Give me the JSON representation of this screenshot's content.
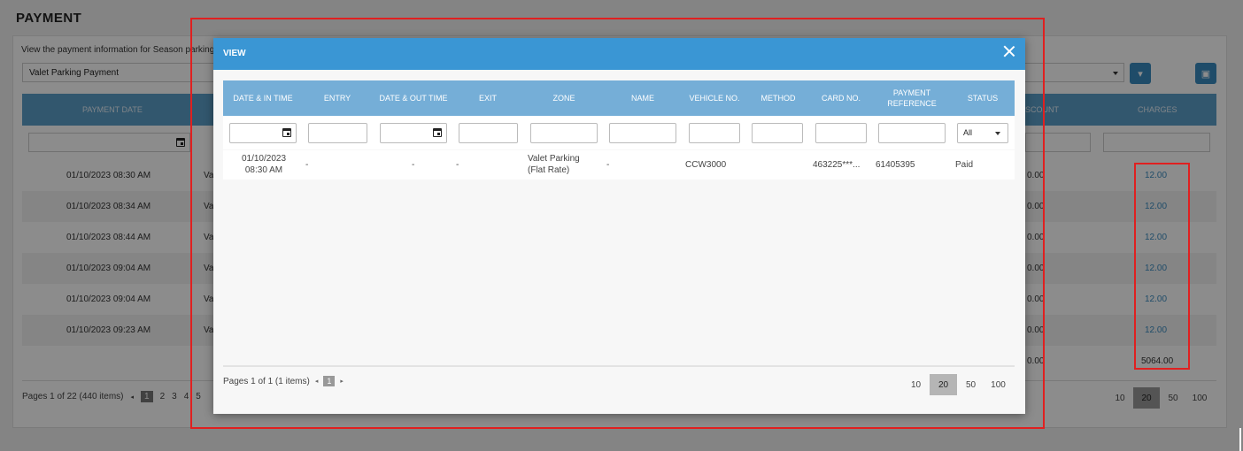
{
  "page": {
    "title": "PAYMENT",
    "description": "View the payment information for Season parking a",
    "payment_type": "Valet Parking Payment",
    "columns": {
      "payment_date": "PAYMENT DATE",
      "discount": "SCOUNT",
      "charges": "CHARGES"
    },
    "rows": [
      {
        "date": "01/10/2023 08:30 AM",
        "type": "Va",
        "discount": "0.00",
        "charges": "12.00"
      },
      {
        "date": "01/10/2023 08:34 AM",
        "type": "Va",
        "discount": "0.00",
        "charges": "12.00"
      },
      {
        "date": "01/10/2023 08:44 AM",
        "type": "Va",
        "discount": "0.00",
        "charges": "12.00"
      },
      {
        "date": "01/10/2023 09:04 AM",
        "type": "Va",
        "discount": "0.00",
        "charges": "12.00"
      },
      {
        "date": "01/10/2023 09:04 AM",
        "type": "Va",
        "discount": "0.00",
        "charges": "12.00"
      },
      {
        "date": "01/10/2023 09:23 AM",
        "type": "Va",
        "discount": "0.00",
        "charges": "12.00"
      }
    ],
    "totals": {
      "discount": "0.00",
      "charges": "5064.00"
    },
    "pager": {
      "summary": "Pages 1 of 22 (440 items)",
      "prev": "◂",
      "pages": [
        "1",
        "2",
        "3",
        "4",
        "5"
      ]
    },
    "page_sizes": [
      "10",
      "20",
      "50",
      "100"
    ],
    "active_page_size": "20",
    "icons": {
      "filter": "filter-icon",
      "print": "print-icon",
      "calendar": "calendar-icon"
    }
  },
  "modal": {
    "title": "VIEW",
    "columns": [
      {
        "key": "date_in",
        "label": "DATE & IN TIME"
      },
      {
        "key": "entry",
        "label": "ENTRY"
      },
      {
        "key": "date_out",
        "label": "DATE & OUT TIME"
      },
      {
        "key": "exit",
        "label": "EXIT"
      },
      {
        "key": "zone",
        "label": "ZONE"
      },
      {
        "key": "name",
        "label": "NAME"
      },
      {
        "key": "vehicle",
        "label": "VEHICLE NO."
      },
      {
        "key": "method",
        "label": "METHOD"
      },
      {
        "key": "card",
        "label": "CARD NO."
      },
      {
        "key": "payref",
        "label": "PAYMENT REFERENCE"
      },
      {
        "key": "status",
        "label": "STATUS"
      }
    ],
    "status_filter": "All",
    "row": {
      "date_in": "01/10/2023 08:30 AM",
      "entry": "-",
      "date_out": "-",
      "exit": "-",
      "zone": "Valet Parking (Flat Rate)",
      "name": "-",
      "vehicle": "CCW3000",
      "method": "",
      "card": "463225***...",
      "payref": "61405395",
      "status": "Paid"
    },
    "pager": {
      "summary": "Pages 1 of 1 (1 items)",
      "prev": "◂",
      "next": "▸",
      "page": "1"
    },
    "page_sizes": [
      "10",
      "20",
      "50",
      "100"
    ],
    "active_page_size": "20",
    "icons": {
      "close": "close-icon",
      "calendar": "calendar-icon",
      "dropdown": "chevron-down-icon"
    }
  },
  "colors": {
    "header_blue": "#3a96d4",
    "table_head": "#75aed7",
    "highlight_red": "#e02020",
    "link_blue": "#3a8bbf"
  }
}
